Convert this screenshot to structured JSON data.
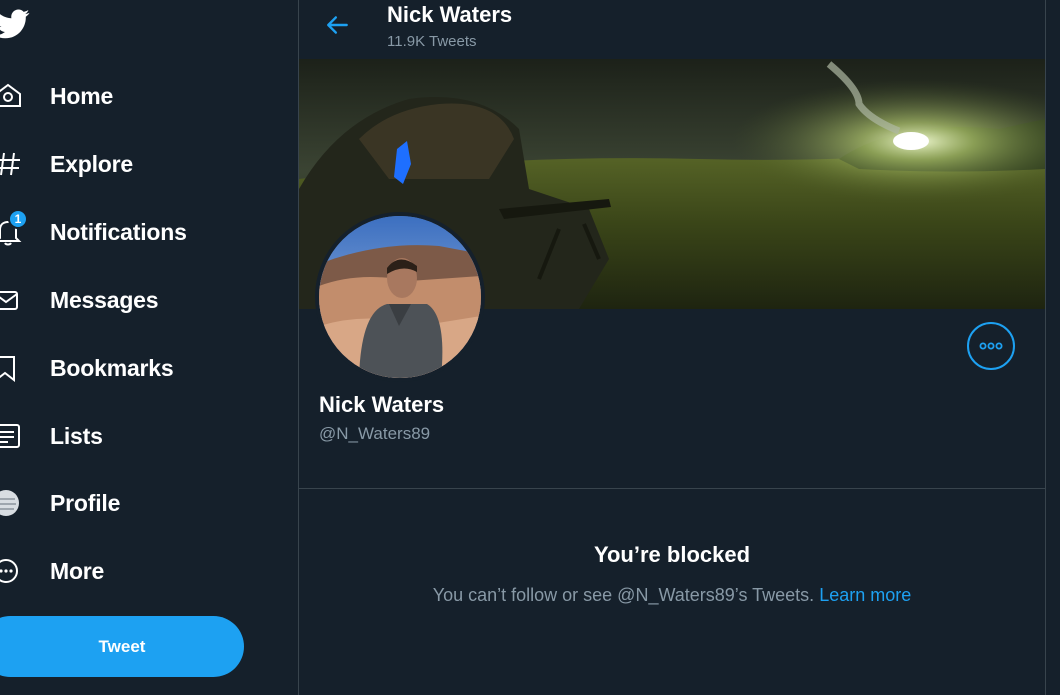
{
  "sidebar": {
    "items": [
      {
        "label": "Home",
        "icon": "home-icon"
      },
      {
        "label": "Explore",
        "icon": "hashtag-icon"
      },
      {
        "label": "Notifications",
        "icon": "bell-icon",
        "badge": "1"
      },
      {
        "label": "Messages",
        "icon": "envelope-icon"
      },
      {
        "label": "Bookmarks",
        "icon": "bookmark-icon"
      },
      {
        "label": "Lists",
        "icon": "list-icon"
      },
      {
        "label": "Profile",
        "icon": "profile-avatar-icon"
      },
      {
        "label": "More",
        "icon": "more-circle-icon"
      }
    ],
    "tweet_button": "Tweet"
  },
  "header": {
    "name": "Nick Waters",
    "tweet_count": "11.9K Tweets"
  },
  "profile": {
    "name": "Nick Waters",
    "handle": "@N_Waters89"
  },
  "blocked": {
    "title": "You’re blocked",
    "message": "You can’t follow or see @N_Waters89’s Tweets.",
    "link": "Learn more"
  },
  "colors": {
    "background": "#15202b",
    "accent": "#1da1f2",
    "secondary_text": "#8899a6",
    "border": "#38444d"
  }
}
